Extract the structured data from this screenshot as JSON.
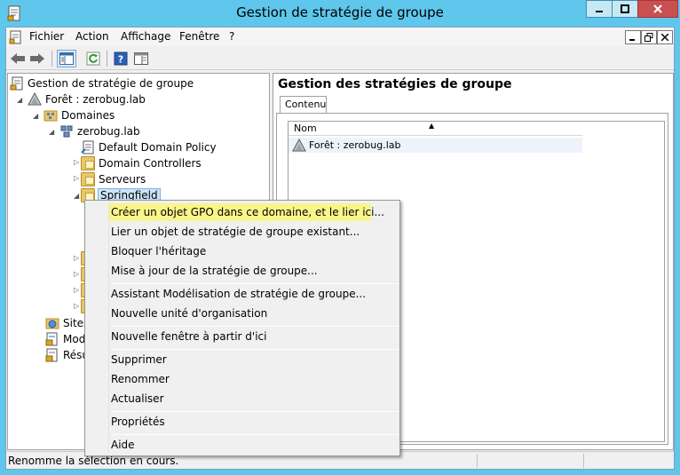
{
  "window": {
    "title": "Gestion de stratégie de groupe"
  },
  "menubar": {
    "items": [
      "Fichier",
      "Action",
      "Affichage",
      "Fenêtre",
      "?"
    ]
  },
  "tree": {
    "root": "Gestion de stratégie de groupe",
    "forest": "Forêt : zerobug.lab",
    "domains": "Domaines",
    "domain": "zerobug.lab",
    "ddp": "Default Domain Policy",
    "dc": "Domain Controllers",
    "servers": "Serveurs",
    "springfield": "Springfield",
    "sites": "Sites",
    "modeling_partial": "Mod",
    "results_partial": "Résu"
  },
  "right_panel": {
    "title": "Gestion des stratégies de groupe",
    "tab": "Contenu",
    "column_header": "Nom",
    "rows": [
      "Forêt : zerobug.lab"
    ]
  },
  "context_menu": {
    "items": [
      "Créer un objet GPO dans ce domaine, et le lier ici...",
      "Lier un objet de stratégie de groupe existant...",
      "Bloquer l'héritage",
      "Mise à jour de la stratégie de groupe...",
      "Assistant Modélisation de stratégie de groupe...",
      "Nouvelle unité d'organisation",
      "Nouvelle fenêtre à partir d'ici",
      "Supprimer",
      "Renommer",
      "Actualiser",
      "Propriétés",
      "Aide"
    ]
  },
  "status": {
    "text": "Renomme la sélection en cours."
  },
  "colors": {
    "frame": "#5fc6ec",
    "close": "#c75050",
    "highlight": "#faf58a",
    "selection": "#cce4f7"
  }
}
